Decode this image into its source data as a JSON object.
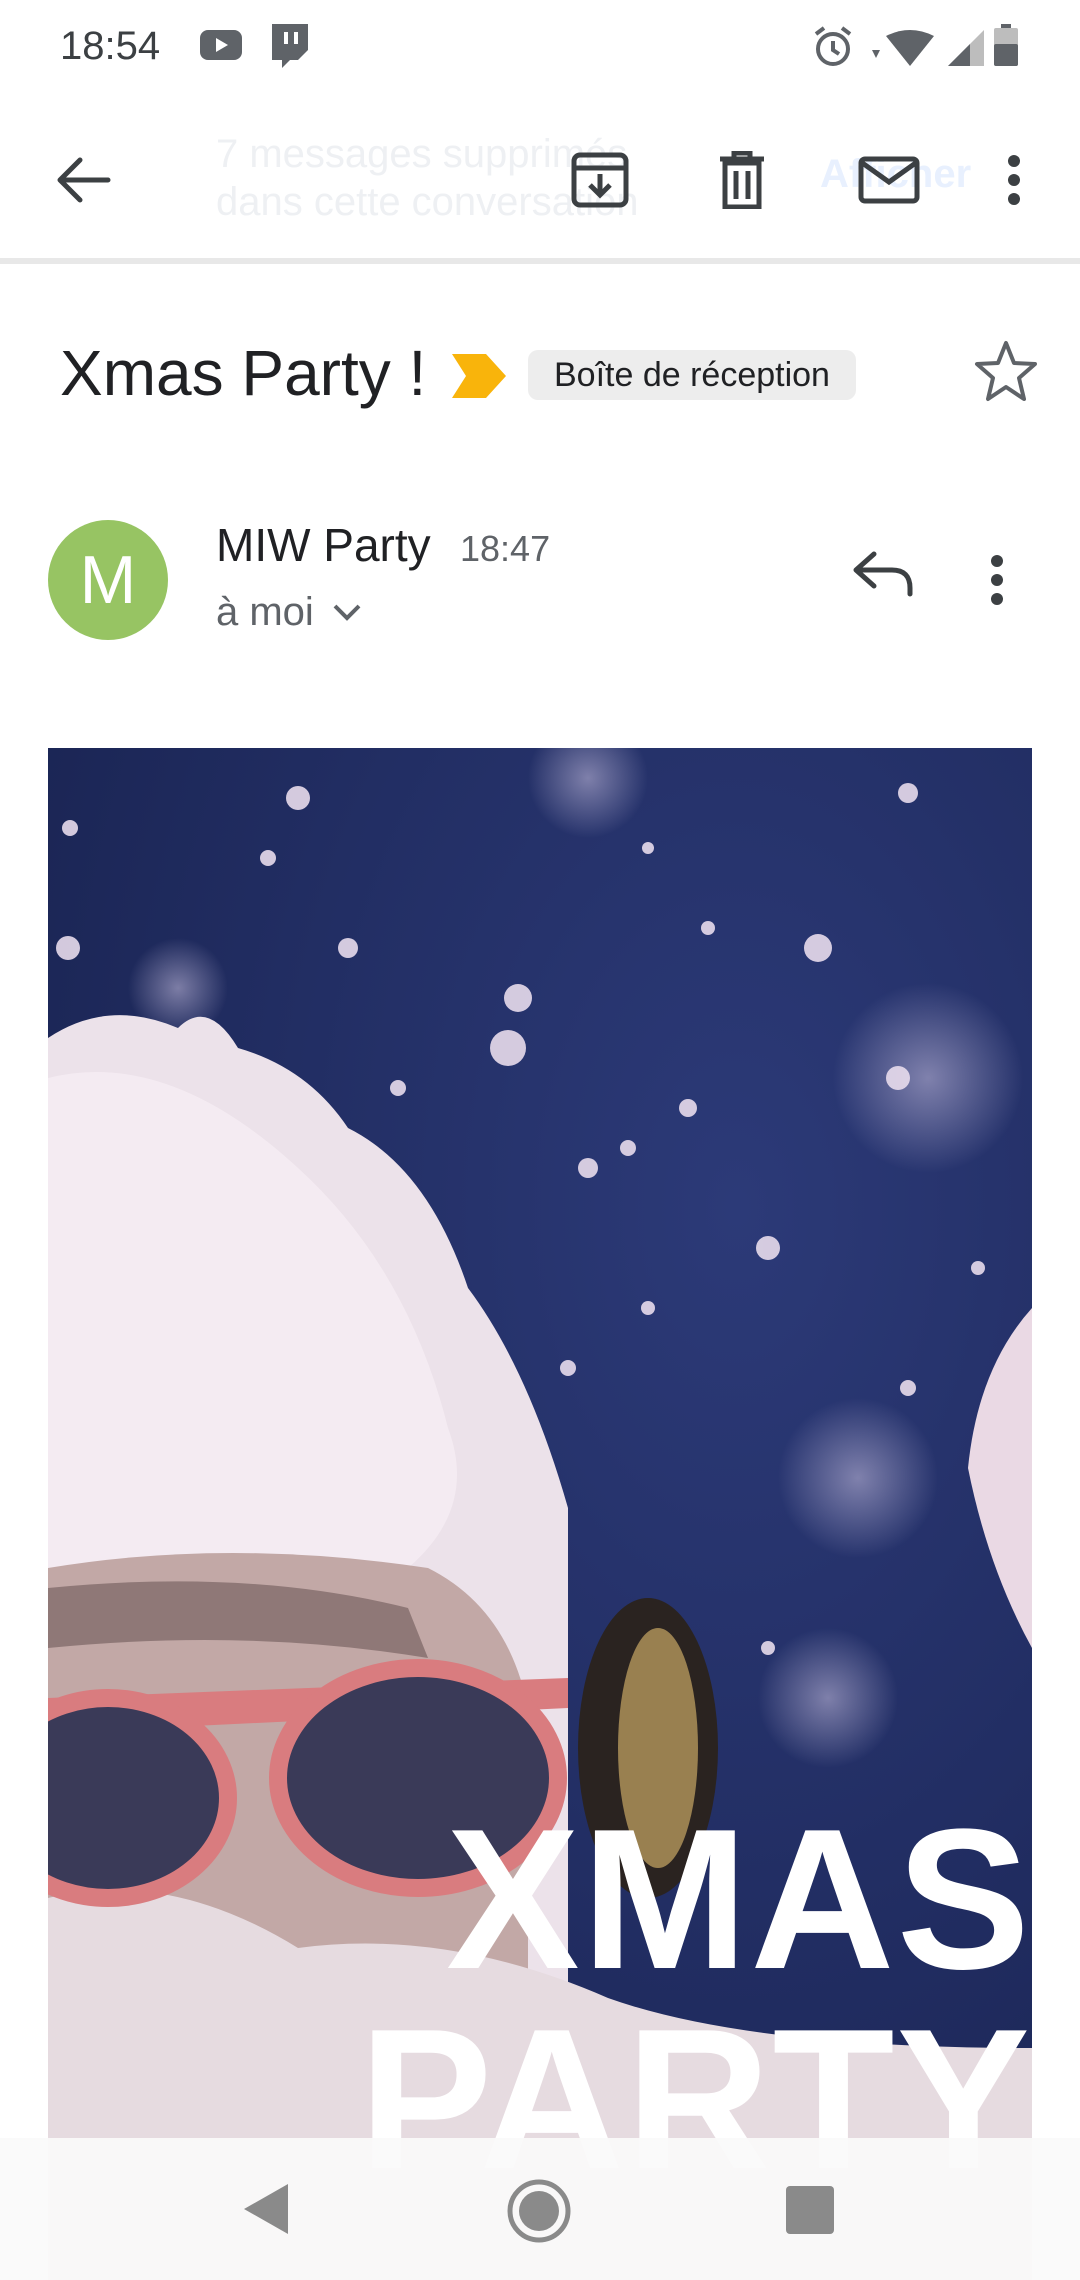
{
  "status_bar": {
    "time": "18:54",
    "icons": [
      "youtube-icon",
      "twitch-icon",
      "alarm-icon",
      "wifi-icon",
      "signal-icon",
      "battery-icon"
    ]
  },
  "toolbar": {
    "back": "arrow-back-icon",
    "ghost_text": "7 messages supprimés dans cette conversation",
    "ghost_attach": "Afficher",
    "actions": [
      "archive-icon",
      "delete-icon",
      "mark-unread-icon",
      "more-vert-icon"
    ]
  },
  "email": {
    "subject": "Xmas Party !",
    "label": "Boîte de réception",
    "sender_initial": "M",
    "sender": "MIW Party",
    "time": "18:47",
    "recipient": "à moi",
    "poster_line1": "XMAS",
    "poster_line2": "PARTY"
  },
  "colors": {
    "avatar": "#97c463",
    "importance": "#f9b40b",
    "poster_background": "#1f2b5c"
  },
  "navbar": {
    "icons": [
      "nav-back-icon",
      "nav-home-icon",
      "nav-recents-icon"
    ]
  }
}
